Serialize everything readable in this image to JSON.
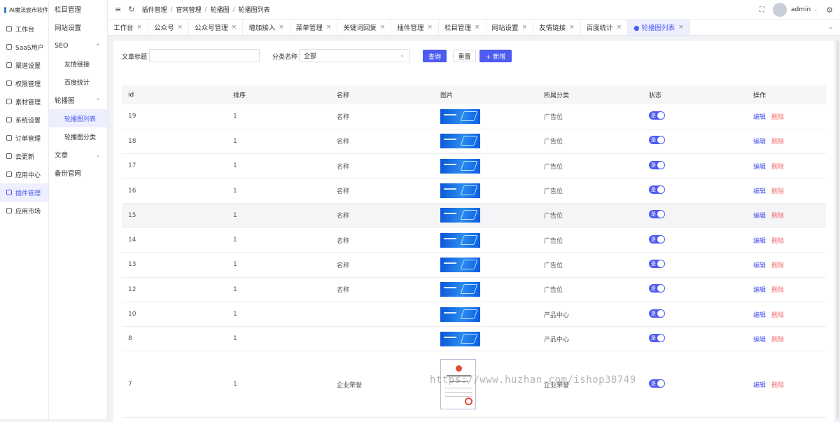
{
  "app": {
    "brand": "AI魔法宸市软件"
  },
  "rail": {
    "items": [
      {
        "label": "工作台"
      },
      {
        "label": "SaaS用户"
      },
      {
        "label": "渠道设置"
      },
      {
        "label": "权限管理"
      },
      {
        "label": "素材管理"
      },
      {
        "label": "系统设置"
      },
      {
        "label": "订单管理"
      },
      {
        "label": "云更新"
      },
      {
        "label": "应用中心"
      },
      {
        "label": "插件管理",
        "active": true
      },
      {
        "label": "应用市场"
      }
    ]
  },
  "submenu": {
    "items": [
      {
        "label": "栏目管理"
      },
      {
        "label": "网站设置"
      },
      {
        "label": "SEO"
      },
      {
        "label": "友情链接"
      },
      {
        "label": "百度统计"
      },
      {
        "label": "轮播图"
      },
      {
        "label": "轮播图列表"
      },
      {
        "label": "轮播图分类"
      },
      {
        "label": "文章"
      },
      {
        "label": "备份官网"
      }
    ]
  },
  "header": {
    "breadcrumb": [
      "插件管理",
      "官网管理",
      "轮播图",
      "轮播图列表"
    ],
    "separator": "/",
    "user": "admin"
  },
  "tabs": [
    {
      "label": "工作台"
    },
    {
      "label": "公众号"
    },
    {
      "label": "公众号管理"
    },
    {
      "label": "增加接入"
    },
    {
      "label": "菜单管理"
    },
    {
      "label": "关键词回复"
    },
    {
      "label": "插件管理"
    },
    {
      "label": "栏目管理"
    },
    {
      "label": "网站设置"
    },
    {
      "label": "友情链接"
    },
    {
      "label": "百度统计"
    },
    {
      "label": "● 轮播图列表",
      "active": true
    }
  ],
  "filters": {
    "title_label": "文章标题",
    "title_value": "",
    "category_label": "分类名称",
    "category_value": "全部",
    "query_button": "查询",
    "reset_button": "重置",
    "add_button": "+ 新增"
  },
  "table": {
    "columns": [
      "id",
      "排序",
      "名称",
      "图片",
      "所属分类",
      "状态",
      "操作"
    ],
    "rows": [
      {
        "id": "19",
        "sort": "1",
        "name": "名称",
        "category": "广告位",
        "image": "banner"
      },
      {
        "id": "18",
        "sort": "1",
        "name": "名称",
        "category": "广告位",
        "image": "banner"
      },
      {
        "id": "17",
        "sort": "1",
        "name": "名称",
        "category": "广告位",
        "image": "banner"
      },
      {
        "id": "16",
        "sort": "1",
        "name": "名称",
        "category": "广告位",
        "image": "banner"
      },
      {
        "id": "15",
        "sort": "1",
        "name": "名称",
        "category": "广告位",
        "image": "banner",
        "highlight": true
      },
      {
        "id": "14",
        "sort": "1",
        "name": "名称",
        "category": "广告位",
        "image": "banner"
      },
      {
        "id": "13",
        "sort": "1",
        "name": "名称",
        "category": "广告位",
        "image": "banner"
      },
      {
        "id": "12",
        "sort": "1",
        "name": "名称",
        "category": "广告位",
        "image": "banner"
      },
      {
        "id": "10",
        "sort": "1",
        "name": "",
        "category": "产品中心",
        "image": "banner"
      },
      {
        "id": "8",
        "sort": "1",
        "name": "",
        "category": "产品中心",
        "image": "banner"
      },
      {
        "id": "7",
        "sort": "1",
        "name": "企业荣誉",
        "category": "企业荣誉",
        "image": "certificate"
      }
    ],
    "status_text": "是",
    "edit_label": "编辑",
    "delete_label": "删除"
  },
  "watermark": "https://www.huzhan.com/ishop38749",
  "colors": {
    "accent": "#4e5bf0",
    "danger": "#f56c6c"
  }
}
